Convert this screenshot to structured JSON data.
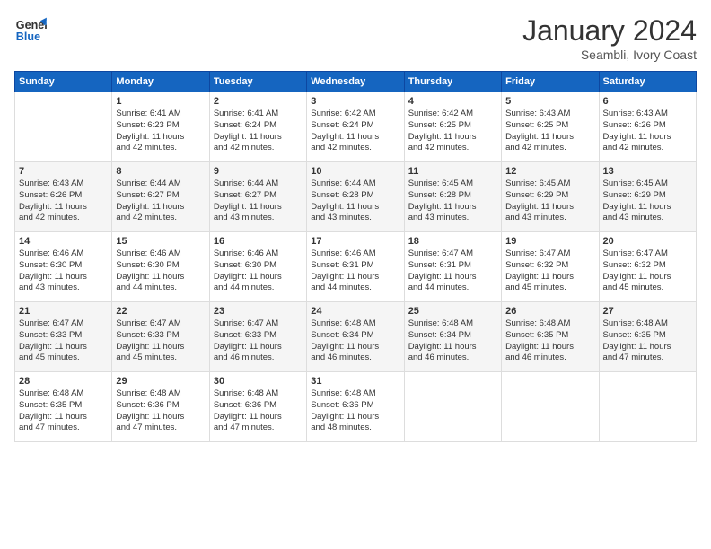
{
  "header": {
    "logo_line1": "General",
    "logo_line2": "Blue",
    "title": "January 2024",
    "subtitle": "Seambli, Ivory Coast"
  },
  "days_of_week": [
    "Sunday",
    "Monday",
    "Tuesday",
    "Wednesday",
    "Thursday",
    "Friday",
    "Saturday"
  ],
  "weeks": [
    [
      {
        "day": "",
        "info": ""
      },
      {
        "day": "1",
        "info": "Sunrise: 6:41 AM\nSunset: 6:23 PM\nDaylight: 11 hours\nand 42 minutes."
      },
      {
        "day": "2",
        "info": "Sunrise: 6:41 AM\nSunset: 6:24 PM\nDaylight: 11 hours\nand 42 minutes."
      },
      {
        "day": "3",
        "info": "Sunrise: 6:42 AM\nSunset: 6:24 PM\nDaylight: 11 hours\nand 42 minutes."
      },
      {
        "day": "4",
        "info": "Sunrise: 6:42 AM\nSunset: 6:25 PM\nDaylight: 11 hours\nand 42 minutes."
      },
      {
        "day": "5",
        "info": "Sunrise: 6:43 AM\nSunset: 6:25 PM\nDaylight: 11 hours\nand 42 minutes."
      },
      {
        "day": "6",
        "info": "Sunrise: 6:43 AM\nSunset: 6:26 PM\nDaylight: 11 hours\nand 42 minutes."
      }
    ],
    [
      {
        "day": "7",
        "info": "Sunrise: 6:43 AM\nSunset: 6:26 PM\nDaylight: 11 hours\nand 42 minutes."
      },
      {
        "day": "8",
        "info": "Sunrise: 6:44 AM\nSunset: 6:27 PM\nDaylight: 11 hours\nand 42 minutes."
      },
      {
        "day": "9",
        "info": "Sunrise: 6:44 AM\nSunset: 6:27 PM\nDaylight: 11 hours\nand 43 minutes."
      },
      {
        "day": "10",
        "info": "Sunrise: 6:44 AM\nSunset: 6:28 PM\nDaylight: 11 hours\nand 43 minutes."
      },
      {
        "day": "11",
        "info": "Sunrise: 6:45 AM\nSunset: 6:28 PM\nDaylight: 11 hours\nand 43 minutes."
      },
      {
        "day": "12",
        "info": "Sunrise: 6:45 AM\nSunset: 6:29 PM\nDaylight: 11 hours\nand 43 minutes."
      },
      {
        "day": "13",
        "info": "Sunrise: 6:45 AM\nSunset: 6:29 PM\nDaylight: 11 hours\nand 43 minutes."
      }
    ],
    [
      {
        "day": "14",
        "info": "Sunrise: 6:46 AM\nSunset: 6:30 PM\nDaylight: 11 hours\nand 43 minutes."
      },
      {
        "day": "15",
        "info": "Sunrise: 6:46 AM\nSunset: 6:30 PM\nDaylight: 11 hours\nand 44 minutes."
      },
      {
        "day": "16",
        "info": "Sunrise: 6:46 AM\nSunset: 6:30 PM\nDaylight: 11 hours\nand 44 minutes."
      },
      {
        "day": "17",
        "info": "Sunrise: 6:46 AM\nSunset: 6:31 PM\nDaylight: 11 hours\nand 44 minutes."
      },
      {
        "day": "18",
        "info": "Sunrise: 6:47 AM\nSunset: 6:31 PM\nDaylight: 11 hours\nand 44 minutes."
      },
      {
        "day": "19",
        "info": "Sunrise: 6:47 AM\nSunset: 6:32 PM\nDaylight: 11 hours\nand 45 minutes."
      },
      {
        "day": "20",
        "info": "Sunrise: 6:47 AM\nSunset: 6:32 PM\nDaylight: 11 hours\nand 45 minutes."
      }
    ],
    [
      {
        "day": "21",
        "info": "Sunrise: 6:47 AM\nSunset: 6:33 PM\nDaylight: 11 hours\nand 45 minutes."
      },
      {
        "day": "22",
        "info": "Sunrise: 6:47 AM\nSunset: 6:33 PM\nDaylight: 11 hours\nand 45 minutes."
      },
      {
        "day": "23",
        "info": "Sunrise: 6:47 AM\nSunset: 6:33 PM\nDaylight: 11 hours\nand 46 minutes."
      },
      {
        "day": "24",
        "info": "Sunrise: 6:48 AM\nSunset: 6:34 PM\nDaylight: 11 hours\nand 46 minutes."
      },
      {
        "day": "25",
        "info": "Sunrise: 6:48 AM\nSunset: 6:34 PM\nDaylight: 11 hours\nand 46 minutes."
      },
      {
        "day": "26",
        "info": "Sunrise: 6:48 AM\nSunset: 6:35 PM\nDaylight: 11 hours\nand 46 minutes."
      },
      {
        "day": "27",
        "info": "Sunrise: 6:48 AM\nSunset: 6:35 PM\nDaylight: 11 hours\nand 47 minutes."
      }
    ],
    [
      {
        "day": "28",
        "info": "Sunrise: 6:48 AM\nSunset: 6:35 PM\nDaylight: 11 hours\nand 47 minutes."
      },
      {
        "day": "29",
        "info": "Sunrise: 6:48 AM\nSunset: 6:36 PM\nDaylight: 11 hours\nand 47 minutes."
      },
      {
        "day": "30",
        "info": "Sunrise: 6:48 AM\nSunset: 6:36 PM\nDaylight: 11 hours\nand 47 minutes."
      },
      {
        "day": "31",
        "info": "Sunrise: 6:48 AM\nSunset: 6:36 PM\nDaylight: 11 hours\nand 48 minutes."
      },
      {
        "day": "",
        "info": ""
      },
      {
        "day": "",
        "info": ""
      },
      {
        "day": "",
        "info": ""
      }
    ]
  ]
}
